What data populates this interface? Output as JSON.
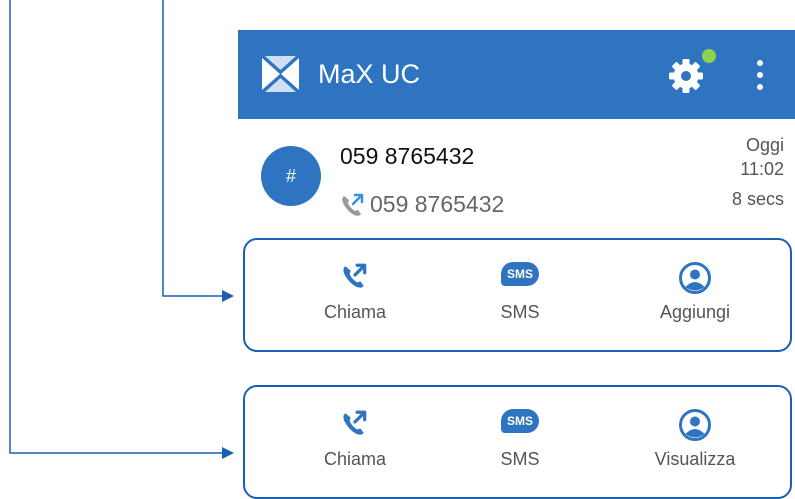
{
  "app": {
    "title": "MaX UC"
  },
  "call": {
    "avatar_symbol": "#",
    "name": "059 8765432",
    "number": "059 8765432",
    "date": "Oggi",
    "time": "11:02",
    "duration": "8 secs"
  },
  "panels": [
    {
      "actions": [
        {
          "label": "Chiama",
          "icon": "outgoing-call-icon"
        },
        {
          "label": "SMS",
          "icon": "sms-icon",
          "badge": "SMS"
        },
        {
          "label": "Aggiungi",
          "icon": "contact-icon"
        }
      ]
    },
    {
      "actions": [
        {
          "label": "Chiama",
          "icon": "outgoing-call-icon"
        },
        {
          "label": "SMS",
          "icon": "sms-icon",
          "badge": "SMS"
        },
        {
          "label": "Visualizza",
          "icon": "contact-icon"
        }
      ]
    }
  ],
  "colors": {
    "primary": "#2f74c0",
    "status": "#8fd14f",
    "callout": "#1a5fb4"
  }
}
